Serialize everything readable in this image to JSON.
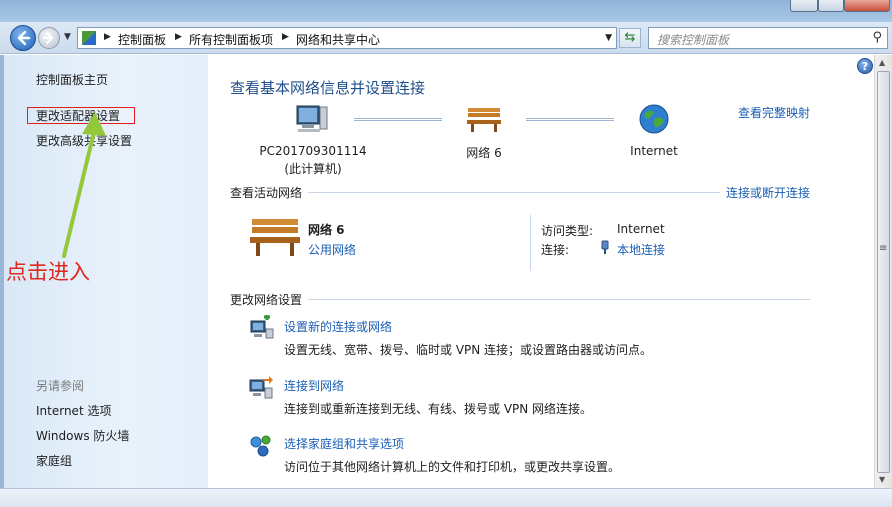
{
  "address_bar": {
    "crumbs": [
      "控制面板",
      "所有控制面板项",
      "网络和共享中心"
    ],
    "search_placeholder": "搜索控制面板"
  },
  "left_pane": {
    "home": "控制面板主页",
    "adapter_settings": "更改适配器设置",
    "advanced_sharing": "更改高级共享设置",
    "see_also": "另请参阅",
    "see_also_items": [
      "Internet 选项",
      "Windows 防火墙",
      "家庭组"
    ]
  },
  "annotation": {
    "text": "点击进入",
    "color": "#e0281c"
  },
  "main": {
    "help": "?",
    "heading": "查看基本网络信息并设置连接",
    "full_map_link": "查看完整映射",
    "nodes": {
      "computer_name": "PC201709301114",
      "computer_sub": "(此计算机)",
      "network": "网络 6",
      "internet": "Internet"
    },
    "active": {
      "title": "查看活动网络",
      "connect_link": "连接或断开连接",
      "network_name": "网络  6",
      "network_type": "公用网络",
      "access_type_label": "访问类型:",
      "access_type_value": "Internet",
      "connections_label": "连接:",
      "connections_value": "本地连接"
    },
    "change": {
      "title": "更改网络设置",
      "tasks": [
        {
          "title": "设置新的连接或网络",
          "desc": "设置无线、宽带、拨号、临时或 VPN 连接；或设置路由器或访问点。"
        },
        {
          "title": "连接到网络",
          "desc": "连接到或重新连接到无线、有线、拨号或 VPN 网络连接。"
        },
        {
          "title": "选择家庭组和共享选项",
          "desc": "访问位于其他网络计算机上的文件和打印机，或更改共享设置。"
        }
      ]
    }
  },
  "colors": {
    "link": "#1a5fb4",
    "heading": "#1f4f8a",
    "highlight_box": "#e02020"
  }
}
